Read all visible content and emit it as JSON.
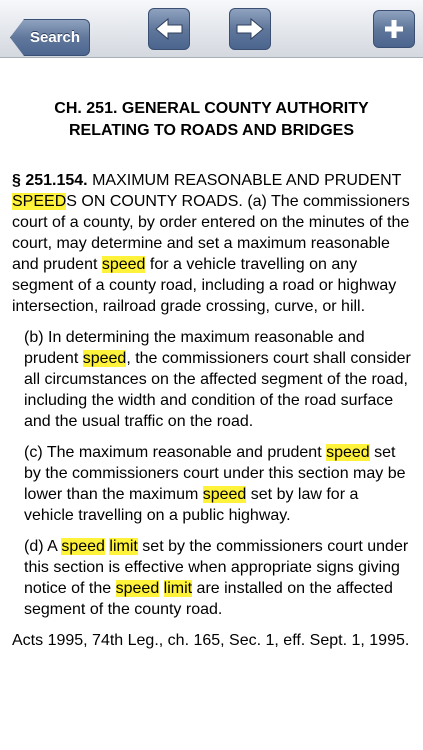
{
  "toolbar": {
    "search_label": "Search",
    "back_icon": "arrow-left-icon",
    "forward_icon": "arrow-right-icon",
    "add_icon": "plus-icon"
  },
  "chapter_title": "CH. 251. GENERAL COUNTY AUTHORITY RELATING TO ROADS AND BRIDGES",
  "section": {
    "number": "§ 251.154.",
    "heading_1": " MAXIMUM REASONABLE AND PRUDENT ",
    "heading_hl": "SPEED",
    "heading_2": "S ON COUNTY ROADS.",
    "a_1": " (a) The commissioners court of a county, by order entered on the minutes of the court, may determine and set a maximum reasonable and prudent ",
    "a_hl": "speed",
    "a_2": " for a vehicle travelling on any segment of a county road, including a road or highway intersection, railroad grade crossing, curve, or hill."
  },
  "b": {
    "t1": "(b) In determining the maximum reasonable and prudent ",
    "hl1": "speed",
    "t2": ", the commissioners court shall consider all circumstances on the affected segment of the road, including the width and condition of the road surface and the usual traffic on the road."
  },
  "c": {
    "t1": "(c) The maximum reasonable and prudent ",
    "hl1": "speed",
    "t2": " set by the commissioners court under this section may be lower than the maximum ",
    "hl2": "speed",
    "t3": " set by law for a vehicle travelling on a public highway."
  },
  "d": {
    "t1": "(d) A ",
    "hl1": "speed",
    "t2": " ",
    "hl2": "limit",
    "t3": " set by the commissioners court under this section is effective when appropriate signs giving notice of the ",
    "hl3": "speed",
    "t4": " ",
    "hl4": "limit",
    "t5": " are installed on the affected segment of the county road."
  },
  "history": "Acts 1995, 74th Leg., ch. 165, Sec. 1, eff. Sept. 1, 1995.",
  "colors": {
    "highlight": "#fff23a",
    "toolbar_button": "#60779b"
  }
}
